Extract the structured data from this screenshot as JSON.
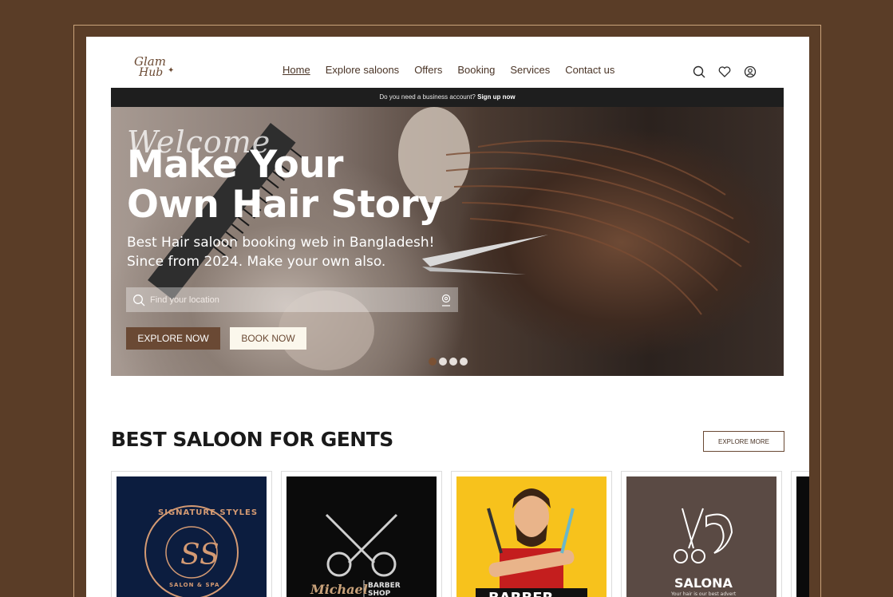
{
  "brand": {
    "logo_line1": "Glam",
    "logo_line2": "Hub"
  },
  "nav": {
    "items": [
      {
        "label": "Home",
        "active": true
      },
      {
        "label": "Explore saloons"
      },
      {
        "label": "Offers"
      },
      {
        "label": "Booking"
      },
      {
        "label": "Services"
      },
      {
        "label": "Contact us"
      }
    ]
  },
  "header_icons": [
    "search-icon",
    "heart-icon",
    "user-icon"
  ],
  "bizbar": {
    "text": "Do you need a business account?",
    "link": "Sign up now"
  },
  "hero": {
    "script": "Welcome",
    "headline_line1": "Make Your",
    "headline_line2": "Own Hair Story",
    "sub_line1": "Best Hair saloon booking web in Bangladesh!",
    "sub_line2": "Since from 2024. Make your own also.",
    "search_placeholder": "Find your location",
    "explore_label": "EXPLORE NOW",
    "book_label": "BOOK NOW",
    "slides": 4,
    "active_slide": 1
  },
  "section": {
    "title": "BEST SALOON FOR GENTS",
    "more_label": "EXPLORE MORE"
  },
  "cards": [
    {
      "name": "signature-styles",
      "caption": "SIGNATURE STYLES",
      "sub": "SALON & SPA",
      "bg": "#0c1d3f"
    },
    {
      "name": "michael-barber-shop",
      "caption": "Michael",
      "sub": "BARBER SHOP",
      "bg": "#0b0b0b"
    },
    {
      "name": "barber",
      "caption": "BARBER",
      "bg": "#f7c21c"
    },
    {
      "name": "salona",
      "caption": "SALONA",
      "sub": "Your hair is our best advert",
      "bg": "#5a4a44"
    }
  ],
  "colors": {
    "accent": "#6a4934",
    "frame": "#5a3d27",
    "dark_bar": "#1e1e1e"
  }
}
